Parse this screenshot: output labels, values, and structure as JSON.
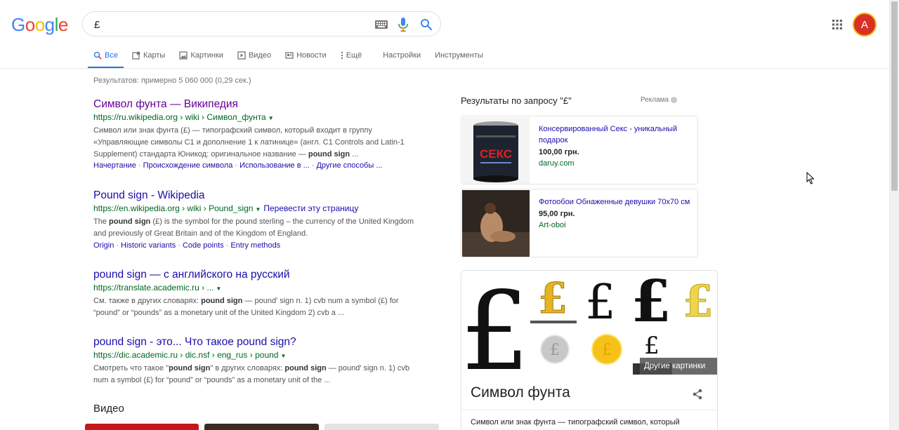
{
  "header": {
    "logo_letters": [
      "G",
      "o",
      "o",
      "g",
      "l",
      "e"
    ],
    "logo_colors": [
      "#4285F4",
      "#EA4335",
      "#FBBC05",
      "#4285F4",
      "#34A853",
      "#EA4335"
    ],
    "search_value": "£",
    "avatar_letter": "A"
  },
  "tabs": [
    {
      "label": "Все",
      "icon": "search-icon"
    },
    {
      "label": "Карты",
      "icon": "map-icon"
    },
    {
      "label": "Картинки",
      "icon": "image-icon"
    },
    {
      "label": "Видео",
      "icon": "video-icon"
    },
    {
      "label": "Новости",
      "icon": "news-icon"
    },
    {
      "label": "Ещё",
      "icon": "more-dots-icon"
    },
    {
      "label": "Настройки"
    },
    {
      "label": "Инструменты"
    }
  ],
  "stats": "Результатов: примерно 5 060 000 (0,29 сек.)",
  "results": [
    {
      "title": "Символ фунта — Википедия",
      "url": "https://ru.wikipedia.org › wiki › Символ_фунта",
      "snippet_lines": [
        "Символ или знак фунта (£) — типографский символ, который входит в группу",
        "«Управляющие символы C1 и дополнение 1 к латинице» (англ. C1 Controls and Latin-1"
      ],
      "snippet_last_pre": "Supplement) стандарта Юникод: оригинальное название — ",
      "snippet_last_bold": "pound sign",
      "snippet_last_post": " ...",
      "links": [
        "Начертание",
        "Происхождение символа",
        "Использование в ...",
        "Другие способы ..."
      ]
    },
    {
      "title": "Pound sign - Wikipedia",
      "url": "https://en.wikipedia.org › wiki › Pound_sign",
      "translate": "Перевести эту страницу",
      "snippet_pre": "The ",
      "snippet_bold": "pound sign",
      "snippet_post": " (£) is the symbol for the pound sterling – the currency of the United Kingdom",
      "snippet_line2": "and previously of Great Britain and of the Kingdom of England.",
      "links": [
        "Origin",
        "Historic variants",
        "Code points",
        "Entry methods"
      ]
    },
    {
      "title": "pound sign — с английского на русский",
      "url": "https://translate.academic.ru › ...",
      "snippet_pre": "См. также в других словарях: ",
      "snippet_bold": "pound sign",
      "snippet_post": " — pound' sign n. 1) cvb num a symbol (£) for",
      "snippet_line2": "“pound” or “pounds” as a monetary unit of the United Kingdom 2) cvb a ..."
    },
    {
      "title": "pound sign - это... Что такое pound sign?",
      "url": "https://dic.academic.ru › dic.nsf › eng_rus › pound",
      "snippet_pre": "Смотреть что такое \"",
      "snippet_bold": "pound sign",
      "snippet_mid": "\" в других словарях: ",
      "snippet_bold2": "pound sign",
      "snippet_post": " — pound' sign n. 1) cvb",
      "snippet_line2": "num a symbol (£) for “pound” or “pounds” as a monetary unit of the ..."
    }
  ],
  "video_heading": "Видео",
  "ads": {
    "title": "Результаты по запросу \"£\"",
    "label": "Реклама",
    "items": [
      {
        "name": "Консервированный Секс - уникальный подарок",
        "price": "100,00 грн.",
        "shop": "daruy.com",
        "can_text": "СЕКС"
      },
      {
        "name": "Фотообои Обнаженные девушки 70х70 см",
        "price": "95,00 грн.",
        "shop": "Art-oboi"
      }
    ]
  },
  "knowledge": {
    "glyph": "£",
    "more_images": "Другие картинки",
    "title": "Символ фунта",
    "desc": "Символ или знак фунта — типографский символ, который"
  }
}
